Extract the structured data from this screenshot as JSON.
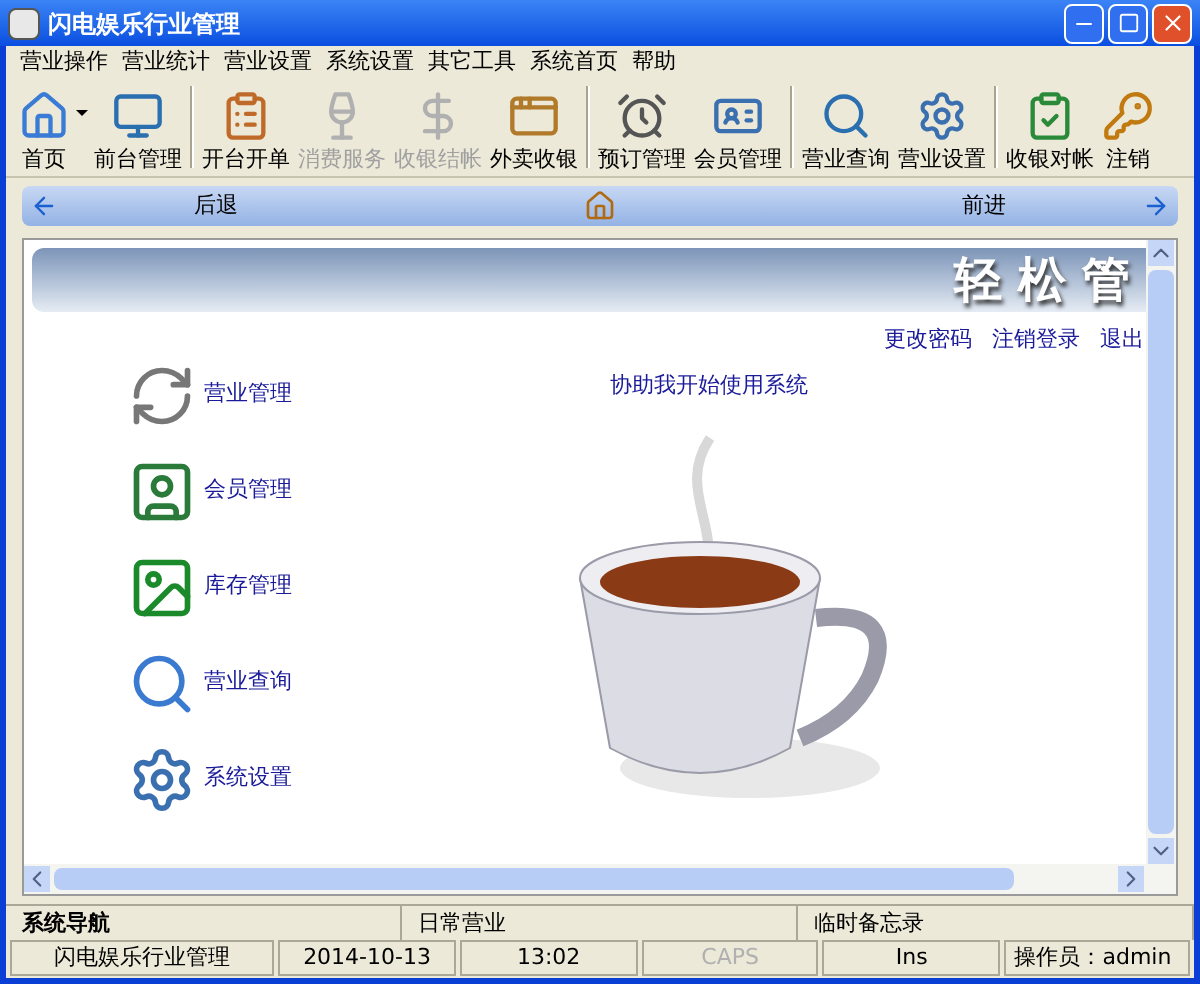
{
  "window": {
    "title": "闪电娱乐行业管理"
  },
  "menu": [
    "营业操作",
    "营业统计",
    "营业设置",
    "系统设置",
    "其它工具",
    "系统首页",
    "帮助"
  ],
  "toolbar": [
    {
      "label": "首页",
      "disabled": false
    },
    {
      "label": "前台管理",
      "disabled": false
    },
    {
      "label": "开台开单",
      "disabled": false
    },
    {
      "label": "消费服务",
      "disabled": true
    },
    {
      "label": "收银结帐",
      "disabled": true
    },
    {
      "label": "外卖收银",
      "disabled": false
    },
    {
      "label": "预订管理",
      "disabled": false
    },
    {
      "label": "会员管理",
      "disabled": false
    },
    {
      "label": "营业查询",
      "disabled": false
    },
    {
      "label": "营业设置",
      "disabled": false
    },
    {
      "label": "收银对帐",
      "disabled": false
    },
    {
      "label": "注销",
      "disabled": false
    }
  ],
  "nav_bar": {
    "back": "后退",
    "forward": "前进"
  },
  "content": {
    "banner_title": "轻松管",
    "links": [
      "更改密码",
      "注销登录",
      "退出"
    ],
    "help_link": "协助我开始使用系统",
    "items": [
      "营业管理",
      "会员管理",
      "库存管理",
      "营业查询",
      "系统设置"
    ]
  },
  "panels": [
    {
      "label": "系统导航",
      "bold": true
    },
    {
      "label": "日常营业",
      "bold": false
    },
    {
      "label": "临时备忘录",
      "bold": false
    }
  ],
  "status_bar": [
    {
      "text": "闪电娱乐行业管理",
      "disabled": false
    },
    {
      "text": "2014-10-13",
      "disabled": false
    },
    {
      "text": "13:02",
      "disabled": false
    },
    {
      "text": "CAPS",
      "disabled": true
    },
    {
      "text": "Ins",
      "disabled": false
    },
    {
      "text": "操作员：admin",
      "disabled": false
    }
  ]
}
